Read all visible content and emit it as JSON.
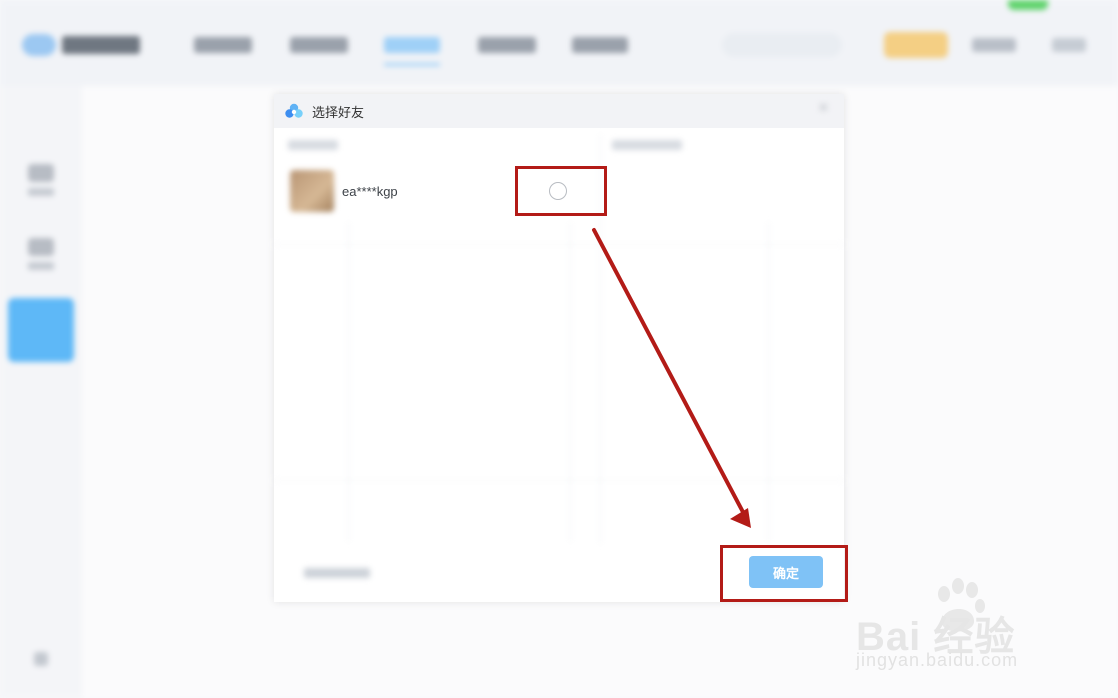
{
  "dialog": {
    "title": "选择好友",
    "friend": {
      "name": "ea****kgp"
    },
    "confirm_label": "确定"
  },
  "watermark": {
    "logo_text": "Bai  经验",
    "url": "jingyan.baidu.com"
  },
  "colors": {
    "annotation_red": "#b31b17",
    "confirm_blue": "#7fc2f6",
    "sidebar_active": "#5eb8f7"
  }
}
